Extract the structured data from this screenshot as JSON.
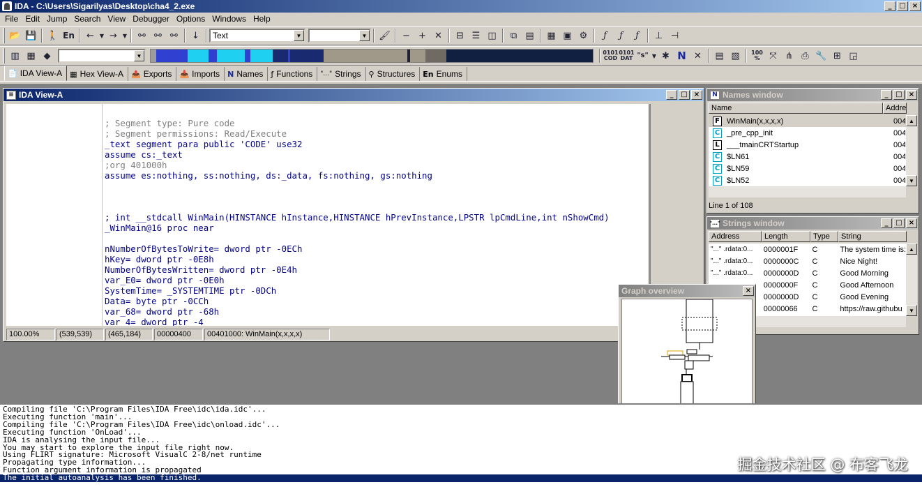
{
  "window": {
    "title": "IDA - C:\\Users\\Sigarilyas\\Desktop\\cha4_2.exe",
    "minimize": "_",
    "maximize": "□",
    "close": "×"
  },
  "menu": [
    "File",
    "Edit",
    "Jump",
    "Search",
    "View",
    "Debugger",
    "Options",
    "Windows",
    "Help"
  ],
  "toolbar": {
    "en_label": "En",
    "text_combo": "Text",
    "hex_labels": [
      "0101 COD",
      "0101 DAT",
      "\"s\""
    ],
    "n_label": "N",
    "zoom_label": "100 %"
  },
  "tabs": [
    {
      "label": "IDA View-A",
      "icon": "📄"
    },
    {
      "label": "Hex View-A",
      "icon": "▦"
    },
    {
      "label": "Exports",
      "icon": "📤"
    },
    {
      "label": "Imports",
      "icon": "📥"
    },
    {
      "label": "Names",
      "icon": "N"
    },
    {
      "label": "Functions",
      "icon": "ƒ"
    },
    {
      "label": "Strings",
      "icon": "\"...\""
    },
    {
      "label": "Structures",
      "icon": "⚲"
    },
    {
      "label": "Enums",
      "icon": "En"
    }
  ],
  "ida_view": {
    "title": "IDA View-A",
    "lines": [
      {
        "text": "; Segment type: Pure code",
        "cls": "c"
      },
      {
        "text": "; Segment permissions: Read/Execute",
        "cls": "c"
      },
      {
        "text": "_text segment para public 'CODE' use32",
        "cls": "n"
      },
      {
        "text": "assume cs:_text",
        "cls": "n"
      },
      {
        "text": ";org 401000h",
        "cls": "c"
      },
      {
        "text": "assume es:nothing, ss:nothing, ds:_data, fs:nothing, gs:nothing",
        "cls": "n"
      },
      {
        "text": "",
        "cls": "n"
      },
      {
        "text": "",
        "cls": "n"
      },
      {
        "text": "",
        "cls": "n"
      },
      {
        "text": "; int __stdcall WinMain(HINSTANCE hInstance,HINSTANCE hPrevInstance,LPSTR lpCmdLine,int nShowCmd)",
        "cls": "n"
      },
      {
        "text": "_WinMain@16 proc near",
        "cls": "n"
      },
      {
        "text": "",
        "cls": "n"
      },
      {
        "text": "nNumberOfBytesToWrite= dword ptr -0ECh",
        "cls": "n"
      },
      {
        "text": "hKey= dword ptr -0E8h",
        "cls": "n"
      },
      {
        "text": "NumberOfBytesWritten= dword ptr -0E4h",
        "cls": "n"
      },
      {
        "text": "var_E0= dword ptr -0E0h",
        "cls": "n"
      },
      {
        "text": "SystemTime= _SYSTEMTIME ptr -0DCh",
        "cls": "n"
      },
      {
        "text": "Data= byte ptr -0CCh",
        "cls": "n"
      },
      {
        "text": "var_68= dword ptr -68h",
        "cls": "n"
      },
      {
        "text": "var_4= dword ptr -4",
        "cls": "n"
      }
    ],
    "status": [
      "100.00%",
      "(539,539)",
      "(465,184)",
      "00000400",
      "00401000: WinMain(x,x,x,x)"
    ]
  },
  "names_window": {
    "title": "Names window",
    "columns": [
      "Name",
      "Addre"
    ],
    "rows": [
      {
        "icon": "F",
        "name": "WinMain(x,x,x,x)",
        "addr": "0040"
      },
      {
        "icon": "C",
        "name": "_pre_cpp_init",
        "addr": "0040"
      },
      {
        "icon": "L",
        "name": "___tmainCRTStartup",
        "addr": "0040"
      },
      {
        "icon": "C",
        "name": "$LN61",
        "addr": "0040"
      },
      {
        "icon": "C",
        "name": "$LN59",
        "addr": "0040"
      },
      {
        "icon": "C",
        "name": "$LN52",
        "addr": "0040"
      }
    ],
    "line_info": "Line 1 of 108"
  },
  "strings_window": {
    "title": "Strings window",
    "columns": [
      "Address",
      "Length",
      "Type",
      "String"
    ],
    "rows": [
      {
        "addr": "\"...\" .rdata:0...",
        "len": "0000001F",
        "type": "C",
        "str": "The system time is:"
      },
      {
        "addr": "\"...\" .rdata:0...",
        "len": "0000000C",
        "type": "C",
        "str": "Nice Night!"
      },
      {
        "addr": "\"...\" .rdata:0...",
        "len": "0000000D",
        "type": "C",
        "str": "Good Morning"
      },
      {
        "addr": "",
        "len": "0000000F",
        "type": "C",
        "str": "Good Afternoon"
      },
      {
        "addr": "",
        "len": "0000000D",
        "type": "C",
        "str": "Good Evening"
      },
      {
        "addr": "",
        "len": "00000066",
        "type": "C",
        "str": "https://raw.githubu"
      }
    ]
  },
  "graph_overview": {
    "title": "Graph overview",
    "close": "×"
  },
  "output": {
    "lines": [
      "Compiling file 'C:\\Program Files\\IDA Free\\idc\\ida.idc'...",
      "Executing function 'main'...",
      "Compiling file 'C:\\Program Files\\IDA Free\\idc\\onload.idc'...",
      "Executing function 'OnLoad'...",
      "IDA is analysing the input file...",
      "You may start to explore the input file right now.",
      "Using FLIRT signature: Microsoft VisualC 2-8/net runtime",
      "Propagating type information...",
      "Function argument information is propagated"
    ],
    "last_line": "The initial autoanalysis has been finished."
  },
  "watermark": "掘金技术社区 @ 布客飞龙"
}
